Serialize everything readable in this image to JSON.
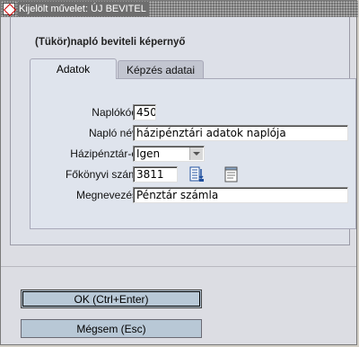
{
  "window": {
    "title": "Kijelölt művelet: ÚJ BEVITEL"
  },
  "form": {
    "heading": "(Tükör)napló beviteli képernyő",
    "tabs": [
      {
        "label": "Adatok",
        "active": true
      },
      {
        "label": "Képzés adatai",
        "active": false
      }
    ],
    "fields": {
      "naplokod": {
        "label": "Naplókód",
        "value": "450"
      },
      "naplo_nev": {
        "label": "Napló név",
        "value": "házipénztári adatok naplója"
      },
      "hazipenztar": {
        "label": "Házipénztár-e",
        "value": "Igen"
      },
      "fokonyvi_szam": {
        "label": "Főkönyvi szám",
        "value": "3811"
      },
      "megnevezes": {
        "label": "Megnevezés",
        "value": "Pénztár számla"
      }
    }
  },
  "buttons": {
    "ok": "OK (Ctrl+Enter)",
    "cancel": "Mégsem (Esc)"
  },
  "icons": [
    "app-icon",
    "lookup-list-icon",
    "notepad-icon",
    "dropdown-arrow-icon"
  ],
  "colors": {
    "button_bg": "#b8c8d6",
    "panel_bg": "#dfe4ed",
    "titlebar": "#6e6e6e"
  }
}
